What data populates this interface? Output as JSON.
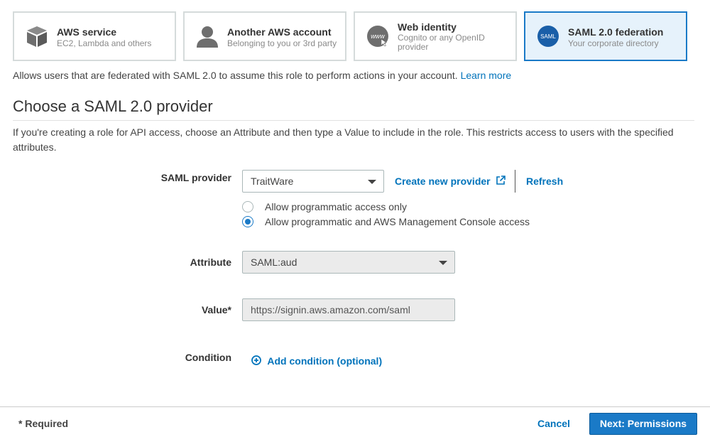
{
  "trust_types": [
    {
      "title": "AWS service",
      "subtitle": "EC2, Lambda and others",
      "icon": "cube-icon"
    },
    {
      "title": "Another AWS account",
      "subtitle": "Belonging to you or 3rd party",
      "icon": "user-icon"
    },
    {
      "title": "Web identity",
      "subtitle": "Cognito or any OpenID provider",
      "icon": "www-globe-icon",
      "icon_text": "www"
    },
    {
      "title": "SAML 2.0 federation",
      "subtitle": "Your corporate directory",
      "icon": "saml-icon",
      "icon_text": "SAML",
      "selected": true
    }
  ],
  "description": {
    "text": "Allows users that are federated with SAML 2.0 to assume this role to perform actions in your account.",
    "link": "Learn more"
  },
  "section": {
    "title": "Choose a SAML 2.0 provider",
    "text": "If you're creating a role for API access, choose an Attribute and then type a Value to include in the role. This restricts access to users with the specified attributes."
  },
  "form": {
    "provider_label": "SAML provider",
    "provider_value": "TraitWare",
    "create_provider_label": "Create new provider",
    "refresh_label": "Refresh",
    "access_options": [
      {
        "label": "Allow programmatic access only",
        "selected": false
      },
      {
        "label": "Allow programmatic and AWS Management Console access",
        "selected": true
      }
    ],
    "attribute_label": "Attribute",
    "attribute_value": "SAML:aud",
    "value_label": "Value*",
    "value_value": "https://signin.aws.amazon.com/saml",
    "condition_label": "Condition",
    "add_condition_label": "Add condition (optional)"
  },
  "footer": {
    "required_note": "* Required",
    "cancel_label": "Cancel",
    "next_label": "Next: Permissions"
  },
  "colors": {
    "accent": "#1a7ac7",
    "link": "#0073bb",
    "selected_card_bg": "#e6f2fb",
    "disabled_field_bg": "#ebebeb"
  }
}
